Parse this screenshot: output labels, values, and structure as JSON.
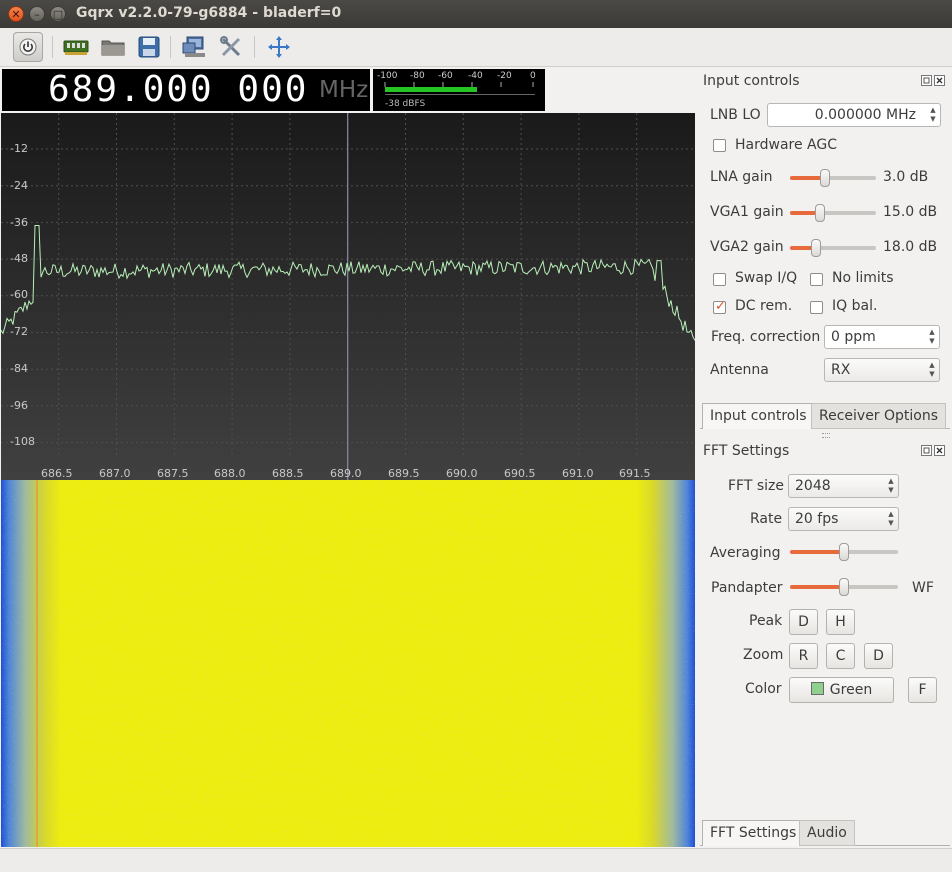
{
  "window": {
    "title": "Gqrx v2.2.0-79-g6884 - bladerf=0"
  },
  "toolbar": {
    "items": [
      "power-icon",
      "hardware-icon",
      "folder-icon",
      "save-icon",
      "network-icon",
      "tools-icon",
      "fullscreen-icon"
    ]
  },
  "frequency": {
    "value": "689.000 000",
    "unit": "MHz"
  },
  "meter": {
    "scale": [
      "-100",
      "-80",
      "-60",
      "-40",
      "-20",
      "0"
    ],
    "level_dbfs": -38,
    "label": "-38 dBFS",
    "colors": {
      "bar": "#26c526"
    }
  },
  "spectrum": {
    "y_ticks": [
      "-12",
      "-24",
      "-36",
      "-48",
      "-60",
      "-72",
      "-84",
      "-96",
      "-108"
    ],
    "x_ticks": [
      "686.5",
      "687.0",
      "687.5",
      "688.0",
      "688.5",
      "689.0",
      "689.5",
      "690.0",
      "690.5",
      "691.0",
      "691.5"
    ],
    "center_freq": 689.0,
    "colors": {
      "trace": "#b8f0b8",
      "background": "#2a2a2a",
      "center_line": "#8a8aa8"
    }
  },
  "waterfall": {
    "colors": {
      "high": "#eded10",
      "low": "#1f4fd6"
    }
  },
  "input_controls": {
    "title": "Input controls",
    "lnb_lo": {
      "label": "LNB LO",
      "value": "0.000000 MHz"
    },
    "hardware_agc": {
      "label": "Hardware AGC",
      "checked": false
    },
    "lna_gain": {
      "label": "LNA gain",
      "value": "3.0 dB",
      "level": 0.4
    },
    "vga1_gain": {
      "label": "VGA1 gain",
      "value": "15.0 dB",
      "level": 0.33
    },
    "vga2_gain": {
      "label": "VGA2 gain",
      "value": "18.0 dB",
      "level": 0.27
    },
    "swap_iq": {
      "label": "Swap I/Q",
      "checked": false
    },
    "no_limits": {
      "label": "No limits",
      "checked": false
    },
    "dc_rem": {
      "label": "DC rem.",
      "checked": true
    },
    "iq_bal": {
      "label": "IQ bal.",
      "checked": false
    },
    "freq_correction": {
      "label": "Freq. correction",
      "value": "0 ppm"
    },
    "antenna": {
      "label": "Antenna",
      "value": "RX"
    }
  },
  "top_tabs": {
    "tab1": "Input controls",
    "tab2": "Receiver Options"
  },
  "fft_settings": {
    "title": "FFT Settings",
    "fft_size": {
      "label": "FFT size",
      "value": "2048"
    },
    "rate": {
      "label": "Rate",
      "value": "20 fps"
    },
    "averaging": {
      "label": "Averaging",
      "level": 0.5
    },
    "pandapter": {
      "label": "Pandapter",
      "right_label": "WF",
      "level": 0.5
    },
    "peak": {
      "label": "Peak",
      "b1": "D",
      "b2": "H"
    },
    "zoom": {
      "label": "Zoom",
      "b1": "R",
      "b2": "C",
      "b3": "D"
    },
    "color": {
      "label": "Color",
      "value": "Green",
      "swatch": "#8fd08f",
      "f_button": "F"
    }
  },
  "bottom_tabs": {
    "tab1": "FFT Settings",
    "tab2": "Audio"
  }
}
